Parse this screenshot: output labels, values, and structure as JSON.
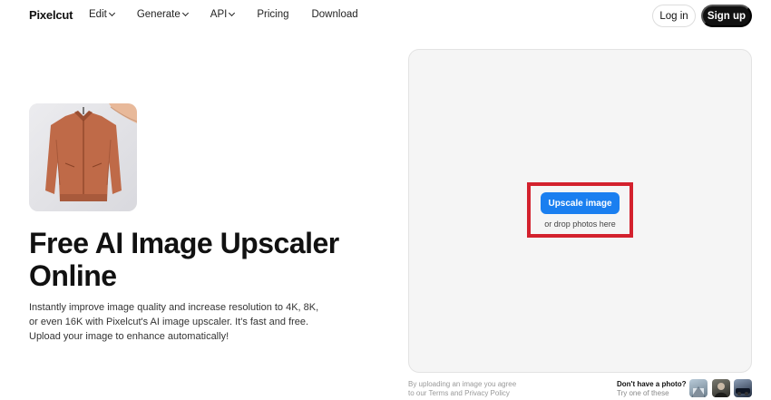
{
  "header": {
    "logo": "Pixelcut",
    "nav": [
      {
        "label": "Edit",
        "has_dropdown": true
      },
      {
        "label": "Generate",
        "has_dropdown": true
      },
      {
        "label": "API",
        "has_dropdown": true
      },
      {
        "label": "Pricing",
        "has_dropdown": false
      },
      {
        "label": "Download",
        "has_dropdown": false
      }
    ],
    "login_label": "Log in",
    "signup_label": "Sign up"
  },
  "hero": {
    "title": "Free AI Image Upscaler Online",
    "description": "Instantly improve image quality and increase resolution to 4K, 8K, or even 16K with Pixelcut's AI image upscaler. It's fast and free. Upload your image to enhance automatically!"
  },
  "upload": {
    "button_label": "Upscale image",
    "drop_text": "or drop photos here",
    "highlight_color": "#d3212d",
    "button_color": "#1a7ff0"
  },
  "footer": {
    "legal_line1": "By uploading an image you agree",
    "legal_line2": "to our Terms and Privacy Policy",
    "no_photo_title": "Don't have a photo?",
    "no_photo_sub": "Try one of these"
  }
}
